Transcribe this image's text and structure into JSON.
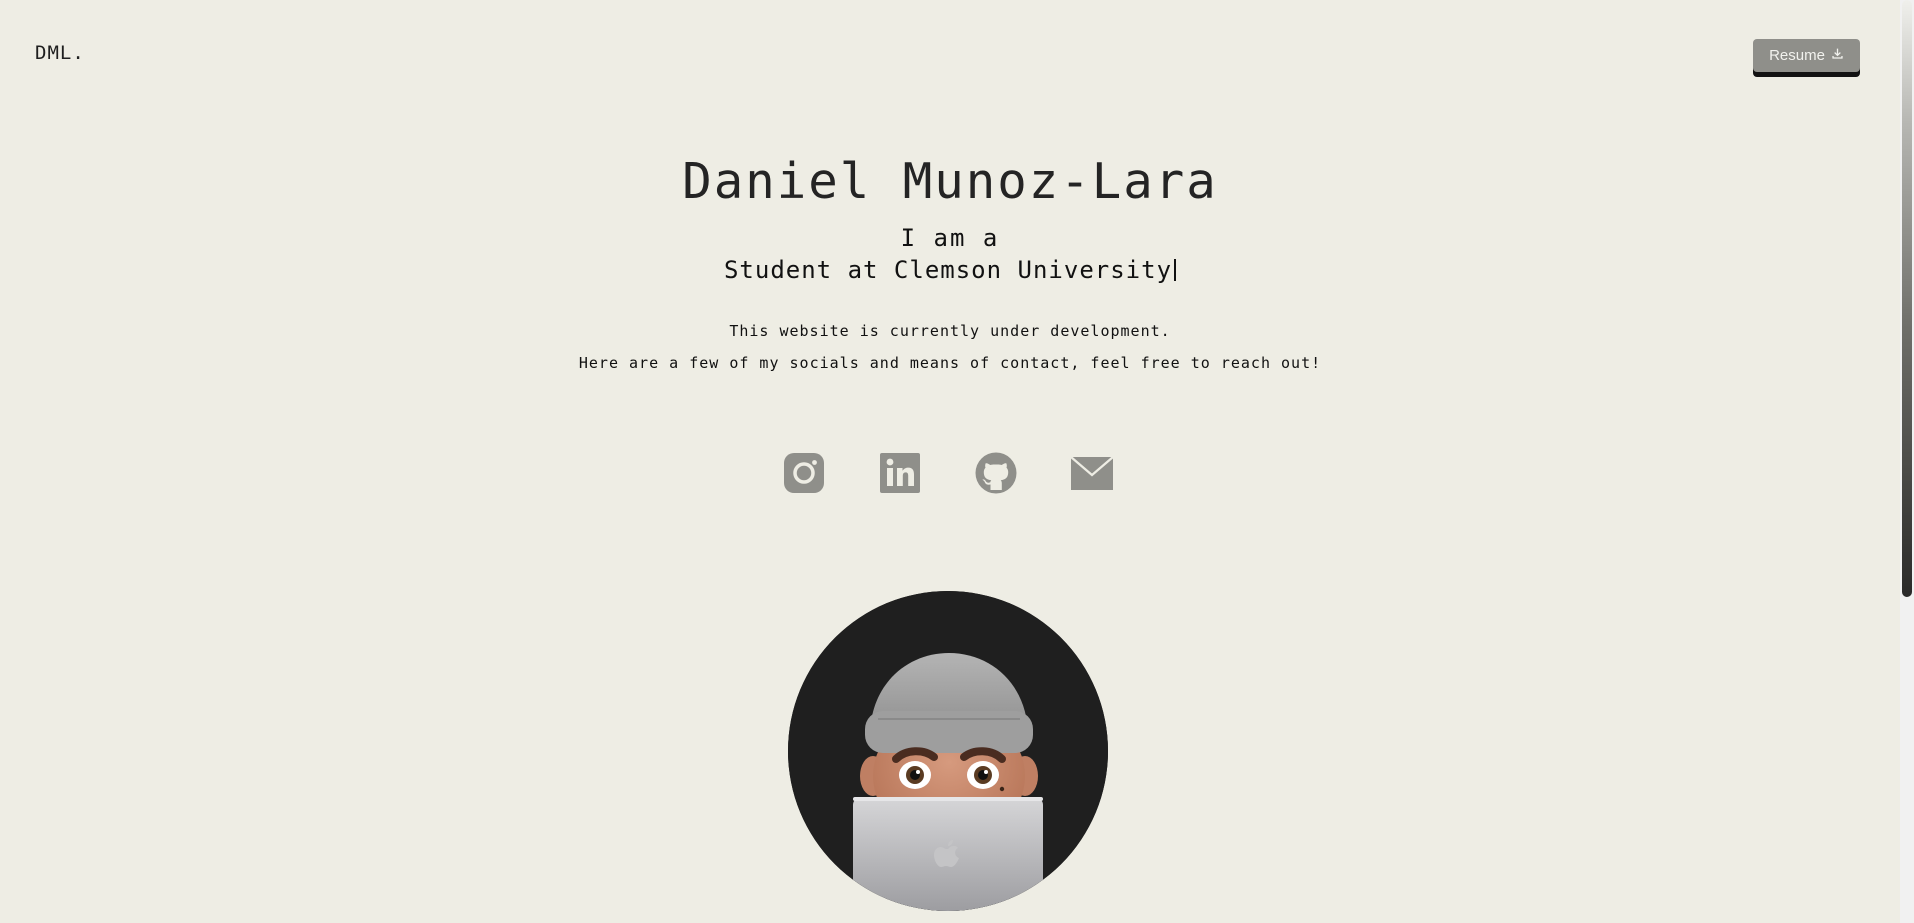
{
  "header": {
    "logo": "DML.",
    "resume_label": "Resume"
  },
  "hero": {
    "name": "Daniel Munoz-Lara",
    "intro": "I am a",
    "role": "Student at Clemson University",
    "note_line1": "This website is currently under development.",
    "note_line2": "Here are a few of my socials and means of contact, feel free to reach out!"
  },
  "socials": [
    {
      "name": "Instagram",
      "icon": "instagram-icon"
    },
    {
      "name": "LinkedIn",
      "icon": "linkedin-icon"
    },
    {
      "name": "GitHub",
      "icon": "github-icon"
    },
    {
      "name": "Email",
      "icon": "mail-icon"
    }
  ],
  "colors": {
    "background": "#eeede4",
    "text": "#1f1f1f",
    "icon": "#8f8f8a",
    "button": "#8f8f8a",
    "avatar_bg": "#1f1f1f"
  }
}
